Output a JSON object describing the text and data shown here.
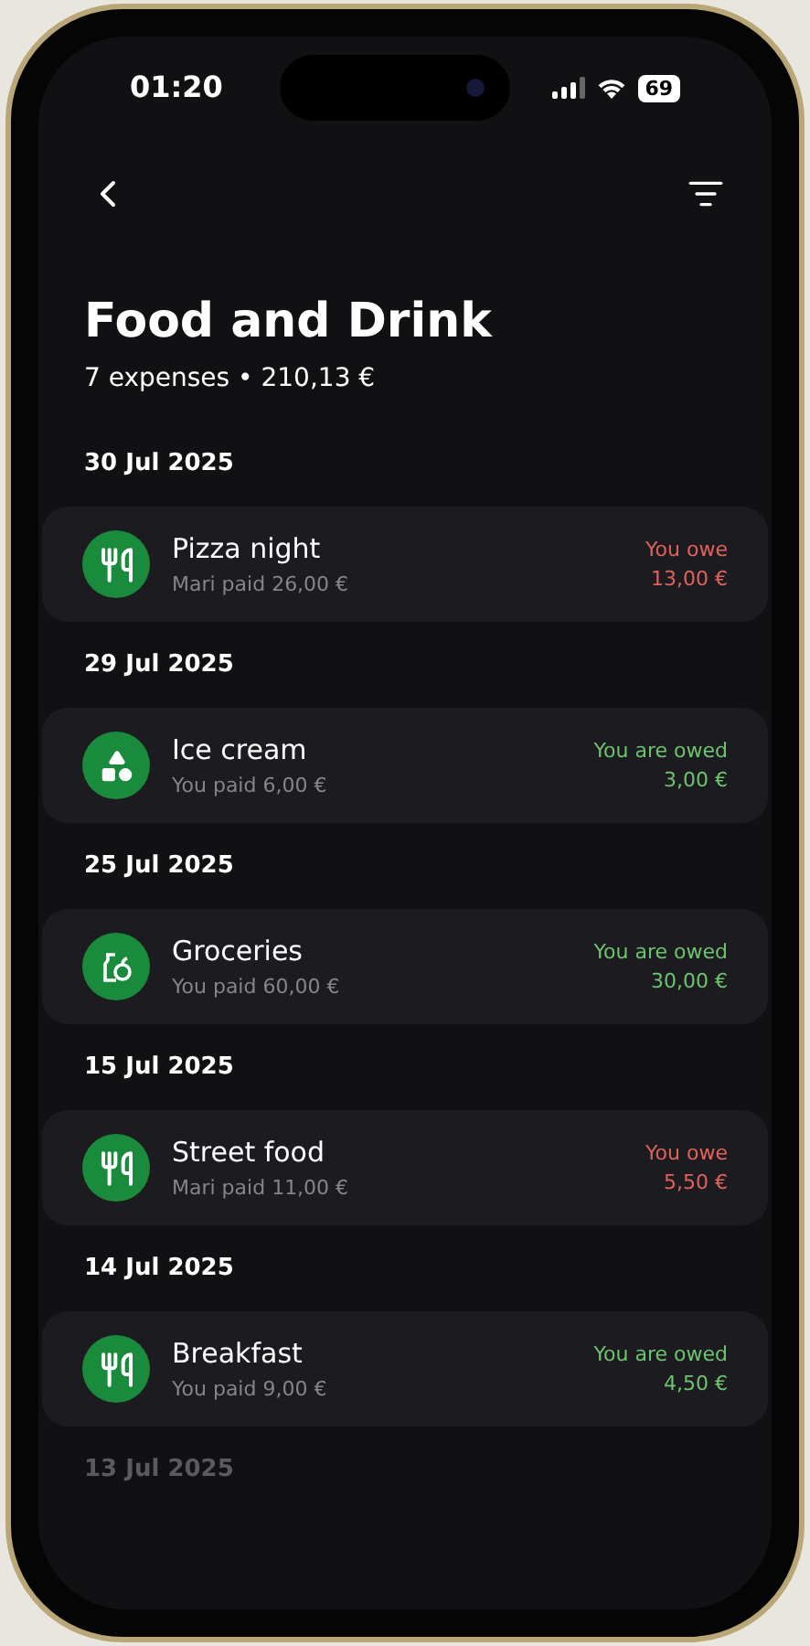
{
  "status_bar": {
    "time": "01:20",
    "battery": "69"
  },
  "header": {
    "title": "Food and Drink",
    "summary": "7 expenses • 210,13 €"
  },
  "groups": [
    {
      "date": "30 Jul 2025",
      "expenses": [
        {
          "name": "Pizza night",
          "paid": "Mari paid 26,00 €",
          "kind": "cutlery",
          "owed": false,
          "balance_label": "You owe",
          "amount": "13,00 €"
        }
      ]
    },
    {
      "date": "29 Jul 2025",
      "expenses": [
        {
          "name": "Ice cream",
          "paid": "You paid 6,00 €",
          "kind": "shapes",
          "owed": true,
          "balance_label": "You are owed",
          "amount": "3,00 €"
        }
      ]
    },
    {
      "date": "25 Jul 2025",
      "expenses": [
        {
          "name": "Groceries",
          "paid": "You paid 60,00 €",
          "kind": "groceries",
          "owed": true,
          "balance_label": "You are owed",
          "amount": "30,00 €"
        }
      ]
    },
    {
      "date": "15 Jul 2025",
      "expenses": [
        {
          "name": "Street food",
          "paid": "Mari paid 11,00 €",
          "kind": "cutlery",
          "owed": false,
          "balance_label": "You owe",
          "amount": "5,50 €"
        }
      ]
    },
    {
      "date": "14 Jul 2025",
      "expenses": [
        {
          "name": "Breakfast",
          "paid": "You paid 9,00 €",
          "kind": "cutlery",
          "owed": true,
          "balance_label": "You are owed",
          "amount": "4,50 €"
        }
      ]
    },
    {
      "date": "13 Jul 2025",
      "faded": true
    }
  ]
}
